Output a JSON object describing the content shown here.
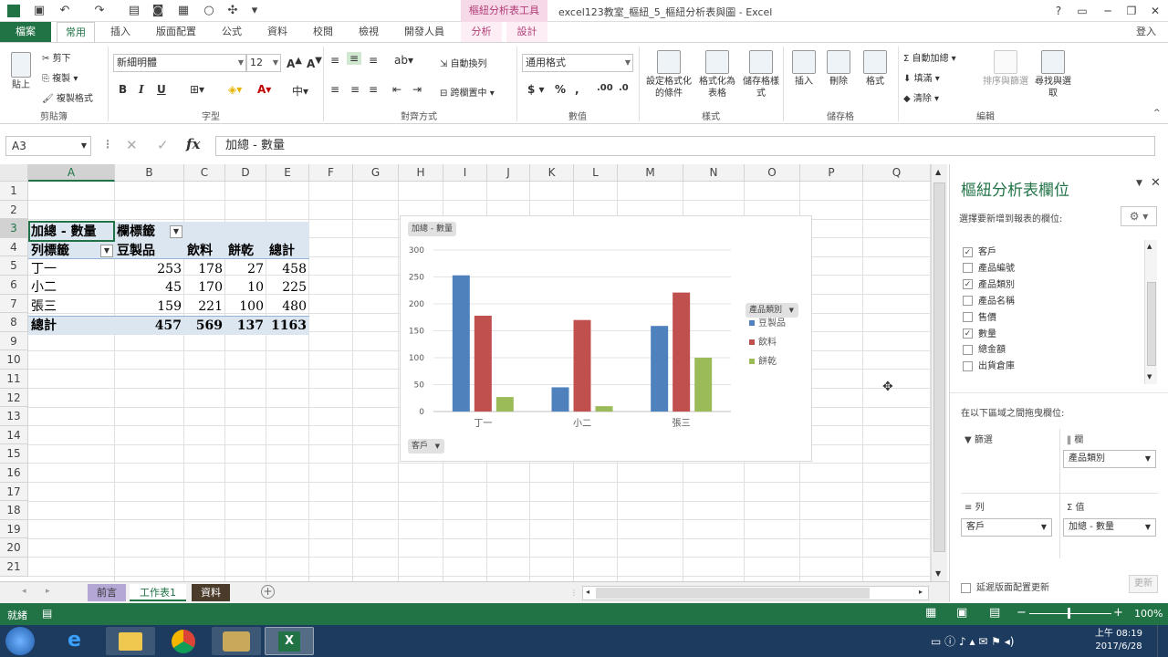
{
  "titlebar": {
    "context_tab": "樞紐分析表工具",
    "window_title": "excel123教室_樞紐_5_樞紐分析表與圖 - Excel",
    "help": "?",
    "user": "登入"
  },
  "tabs": [
    "檔案",
    "常用",
    "插入",
    "版面配置",
    "公式",
    "資料",
    "校閱",
    "檢視",
    "開發人員",
    "分析",
    "設計"
  ],
  "ribbon": {
    "clipboard": {
      "paste": "貼上",
      "cut": "剪下",
      "copy": "複製",
      "format_painter": "複製格式",
      "label": "剪貼簿"
    },
    "font": {
      "name": "新細明體",
      "size": "12",
      "bold": "B",
      "italic": "I",
      "underline": "U",
      "label": "字型"
    },
    "alignment": {
      "wrap": "自動換列",
      "merge": "跨欄置中",
      "label": "對齊方式"
    },
    "number": {
      "format": "通用格式",
      "label": "數值"
    },
    "styles": {
      "conditional": "設定格式化的條件",
      "table": "格式化為表格",
      "cell": "儲存格樣式",
      "label": "樣式"
    },
    "cells": {
      "insert": "插入",
      "delete": "刪除",
      "format": "格式",
      "label": "儲存格"
    },
    "editing": {
      "autosum": "自動加總",
      "fill": "填滿",
      "clear": "清除",
      "sort": "排序與篩選",
      "find": "尋找與選取",
      "label": "編輯"
    }
  },
  "formula_bar": {
    "name_box": "A3",
    "formula": "加總 - 數量"
  },
  "columns": [
    "A",
    "B",
    "C",
    "D",
    "E",
    "F",
    "G",
    "H",
    "I",
    "J",
    "K",
    "L",
    "M",
    "N",
    "O",
    "P",
    "Q"
  ],
  "rows": [
    "1",
    "2",
    "3",
    "4",
    "5",
    "6",
    "7",
    "8",
    "9",
    "10",
    "11",
    "12",
    "13",
    "14",
    "15",
    "16",
    "17",
    "18",
    "19",
    "20",
    "21"
  ],
  "pivot": {
    "value_label": "加總 - 數量",
    "col_label": "欄標籤",
    "row_label": "列標籤",
    "headers": [
      "豆製品",
      "飲料",
      "餅乾",
      "總計"
    ],
    "rows": [
      {
        "name": "丁一",
        "values": [
          "253",
          "178",
          "27",
          "458"
        ]
      },
      {
        "name": "小二",
        "values": [
          "45",
          "170",
          "10",
          "225"
        ]
      },
      {
        "name": "張三",
        "values": [
          "159",
          "221",
          "100",
          "480"
        ]
      }
    ],
    "total": {
      "name": "總計",
      "values": [
        "457",
        "569",
        "137",
        "1163"
      ]
    }
  },
  "chart_data": {
    "type": "bar",
    "value_button": "加總 - 數量",
    "legend_button": "產品類別",
    "axis_button": "客戶",
    "categories": [
      "丁一",
      "小二",
      "張三"
    ],
    "series": [
      {
        "name": "豆製品",
        "values": [
          253,
          45,
          159
        ],
        "color": "#4f81bd"
      },
      {
        "name": "飲料",
        "values": [
          178,
          170,
          221
        ],
        "color": "#c0504d"
      },
      {
        "name": "餅乾",
        "values": [
          27,
          10,
          100
        ],
        "color": "#9bbb59"
      }
    ],
    "yticks": [
      "0",
      "50",
      "100",
      "150",
      "200",
      "250",
      "300"
    ],
    "ylim": [
      0,
      300
    ],
    "legend_position": "right"
  },
  "pane": {
    "title": "樞紐分析表欄位",
    "subtitle": "選擇要新增到報表的欄位:",
    "fields": [
      {
        "name": "客戶",
        "checked": true
      },
      {
        "name": "產品編號",
        "checked": false
      },
      {
        "name": "產品類別",
        "checked": true
      },
      {
        "name": "產品名稱",
        "checked": false
      },
      {
        "name": "售價",
        "checked": false
      },
      {
        "name": "數量",
        "checked": true
      },
      {
        "name": "總金額",
        "checked": false
      },
      {
        "name": "出貨倉庫",
        "checked": false
      }
    ],
    "areas_label": "在以下區域之間拖曳欄位:",
    "filter_label": "篩選",
    "columns_label": "欄",
    "rows_label": "列",
    "values_label": "值",
    "columns_value": "產品類別",
    "rows_value": "客戶",
    "values_value": "加總 - 數量",
    "defer_label": "延遲版面配置更新",
    "update_button": "更新"
  },
  "sheets": [
    "前言",
    "工作表1",
    "資料"
  ],
  "status": {
    "ready": "就緒",
    "zoom": "100%"
  },
  "taskbar": {
    "time": "上午 08:19",
    "date": "2017/6/28"
  }
}
